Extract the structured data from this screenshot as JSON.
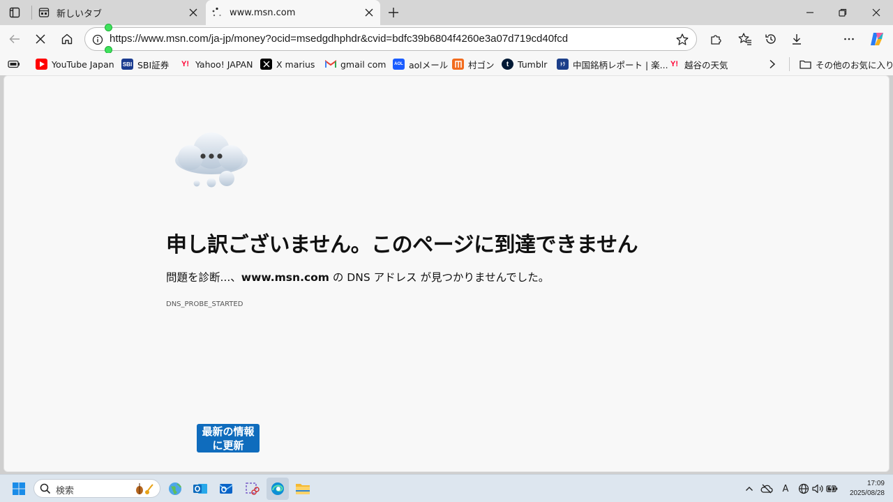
{
  "tabs": [
    {
      "title": "新しいタブ",
      "active": false
    },
    {
      "title": "www.msn.com",
      "active": true
    }
  ],
  "toolbar": {
    "url": "https://www.msn.com/ja-jp/money?ocid=msedgdhphdr&cvid=bdfc39b6804f4260e3a07d719cd40fcd"
  },
  "favorites": [
    {
      "label": "YouTube Japan",
      "icon": "youtube-icon",
      "color": "#ff0000"
    },
    {
      "label": "SBI証券",
      "icon": "sbi-icon",
      "color": "#1a3b8f",
      "glyph": "SBI"
    },
    {
      "label": "Yahoo! JAPAN",
      "icon": "yahoo-icon",
      "color": "#ff0033",
      "glyph": "Y!"
    },
    {
      "label": "X marius",
      "icon": "x-icon",
      "color": "#000000",
      "glyph": "𝕏"
    },
    {
      "label": "gmail com",
      "icon": "gmail-icon",
      "color": "#ea4335",
      "glyph": "M"
    },
    {
      "label": "aolメール",
      "icon": "aol-icon",
      "color": "#1a5cff",
      "glyph": "AOL"
    },
    {
      "label": "村ゴン",
      "icon": "muragon-icon",
      "color": "#f26b1d",
      "glyph": "|||"
    },
    {
      "label": "Tumblr",
      "icon": "tumblr-icon",
      "color": "#001935",
      "glyph": "t"
    },
    {
      "label": "中国銘柄レポート | 楽...",
      "icon": "rakuten-report-icon",
      "color": "#1c3f8a",
      "glyph": "ﾄﾗ"
    },
    {
      "label": "越谷の天気",
      "icon": "yahoo-weather-icon",
      "color": "#ff0033",
      "glyph": "Y!"
    }
  ],
  "other_favorites": "その他のお気に入り",
  "error": {
    "title": "申し訳ございません。このページに到達できません",
    "desc_prefix": "問題を診断...、",
    "desc_host": "www.msn.com",
    "desc_suffix": " の DNS アドレス が見つかりませんでした。",
    "code": "DNS_PROBE_STARTED",
    "refresh_line1": "最新の情報",
    "refresh_line2": "に更新"
  },
  "taskbar": {
    "search_placeholder": "検索",
    "time": "17:09",
    "date": "2025/08/28",
    "ime": "A"
  }
}
